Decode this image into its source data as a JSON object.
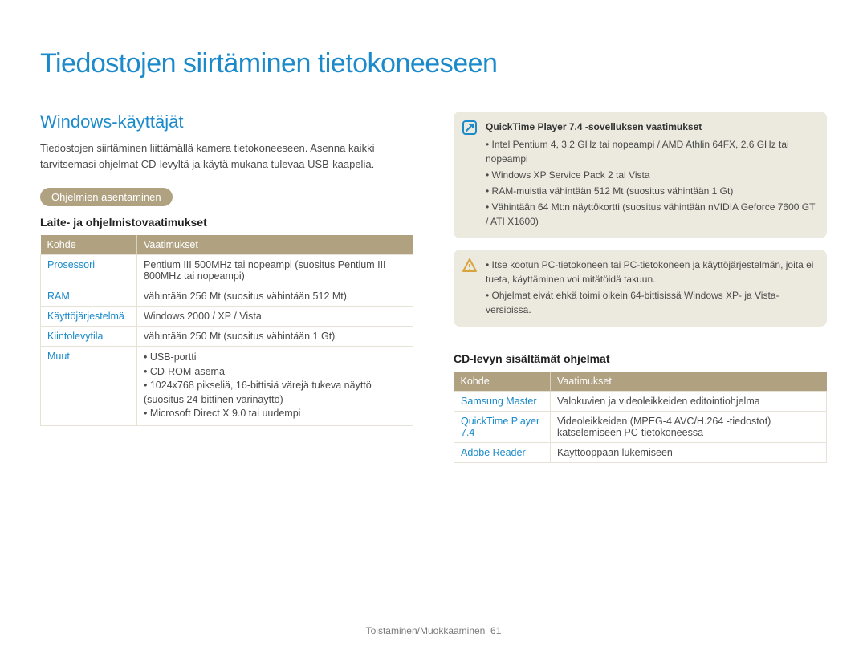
{
  "title": "Tiedostojen siirtäminen tietokoneeseen",
  "left": {
    "heading": "Windows-käyttäjät",
    "intro": "Tiedostojen siirtäminen liittämällä kamera tietokoneeseen. Asenna kaikki tarvitsemasi ohjelmat CD-levyltä ja käytä mukana tulevaa USB-kaapelia.",
    "pill": "Ohjelmien asentaminen",
    "sub": "Laite- ja ohjelmistovaatimukset",
    "table": {
      "head": {
        "col1": "Kohde",
        "col2": "Vaatimukset"
      },
      "rows": [
        {
          "k": "Prosessori",
          "v": "Pentium III 500MHz tai nopeampi (suositus Pentium III 800MHz tai nopeampi)"
        },
        {
          "k": "RAM",
          "v": "vähintään 256 Mt (suositus vähintään 512 Mt)"
        },
        {
          "k": "Käyttöjärjestelmä",
          "v": "Windows 2000 / XP / Vista"
        },
        {
          "k": "Kiintolevytila",
          "v": "vähintään 250 Mt (suositus vähintään 1 Gt)"
        },
        {
          "k": "Muut",
          "list": [
            "USB-portti",
            "CD-ROM-asema",
            "1024x768 pikseliä, 16-bittisiä värejä tukeva näyttö (suositus 24-bittinen värinäyttö)",
            "Microsoft Direct X 9.0 tai uudempi"
          ]
        }
      ]
    }
  },
  "right": {
    "info": {
      "head": "QuickTime Player 7.4 -sovelluksen vaatimukset",
      "items": [
        "Intel Pentium 4, 3.2 GHz tai nopeampi / AMD Athlin 64FX, 2.6 GHz tai nopeampi",
        "Windows XP Service Pack 2 tai Vista",
        "RAM-muistia vähintään 512 Mt (suositus vähintään 1 Gt)",
        "Vähintään 64 Mt:n näyttökortti (suositus vähintään nVIDIA Geforce 7600 GT / ATI X1600)"
      ]
    },
    "warn": {
      "items": [
        "Itse kootun PC-tietokoneen tai PC-tietokoneen ja käyttöjärjestelmän, joita ei tueta, käyttäminen voi mitätöidä takuun.",
        "Ohjelmat eivät ehkä toimi oikein 64-bittisissä Windows XP- ja Vista-versioissa."
      ]
    },
    "sub": "CD-levyn sisältämät ohjelmat",
    "table": {
      "head": {
        "col1": "Kohde",
        "col2": "Vaatimukset"
      },
      "rows": [
        {
          "k": "Samsung Master",
          "v": "Valokuvien ja videoleikkeiden editointiohjelma"
        },
        {
          "k": "QuickTime Player 7.4",
          "v": "Videoleikkeiden (MPEG-4 AVC/H.264 -tiedostot) katselemiseen PC-tietokoneessa"
        },
        {
          "k": "Adobe Reader",
          "v": "Käyttöoppaan lukemiseen"
        }
      ]
    }
  },
  "footer": {
    "section": "Toistaminen/Muokkaaminen",
    "page": "61"
  }
}
